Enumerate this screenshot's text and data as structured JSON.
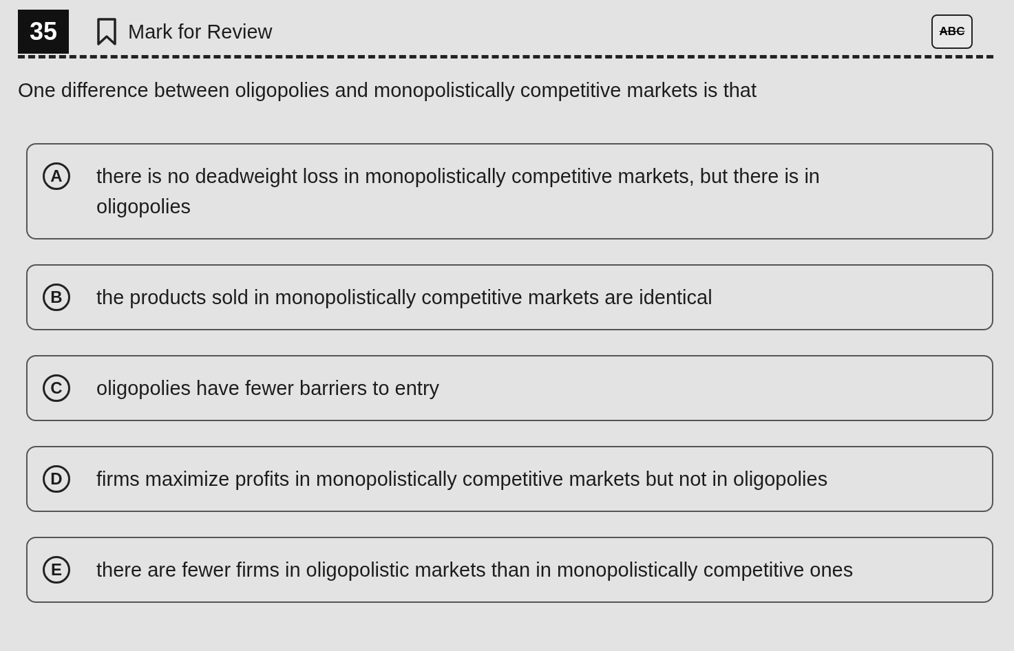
{
  "question": {
    "number": "35",
    "mark_for_review": {
      "label": "Mark for Review",
      "marked": false
    },
    "eliminator": {
      "label": "ABC",
      "on": false
    },
    "prompt": "One difference between oligopolies and monopolistically competitive markets is that"
  },
  "options": [
    {
      "letter": "A",
      "text": "there is no deadweight loss in monopolistically competitive markets, but there is in oligopolies",
      "selected": false
    },
    {
      "letter": "B",
      "text": "the products sold in monopolistically competitive markets are identical",
      "selected": false
    },
    {
      "letter": "C",
      "text": "oligopolies have fewer barriers to entry",
      "selected": false
    },
    {
      "letter": "D",
      "text": "firms maximize profits in monopolistically competitive markets but not in oligopolies",
      "selected": false
    },
    {
      "letter": "E",
      "text": "there are fewer firms in oligopolistic markets than in monopolistically competitive ones",
      "selected": false
    }
  ]
}
